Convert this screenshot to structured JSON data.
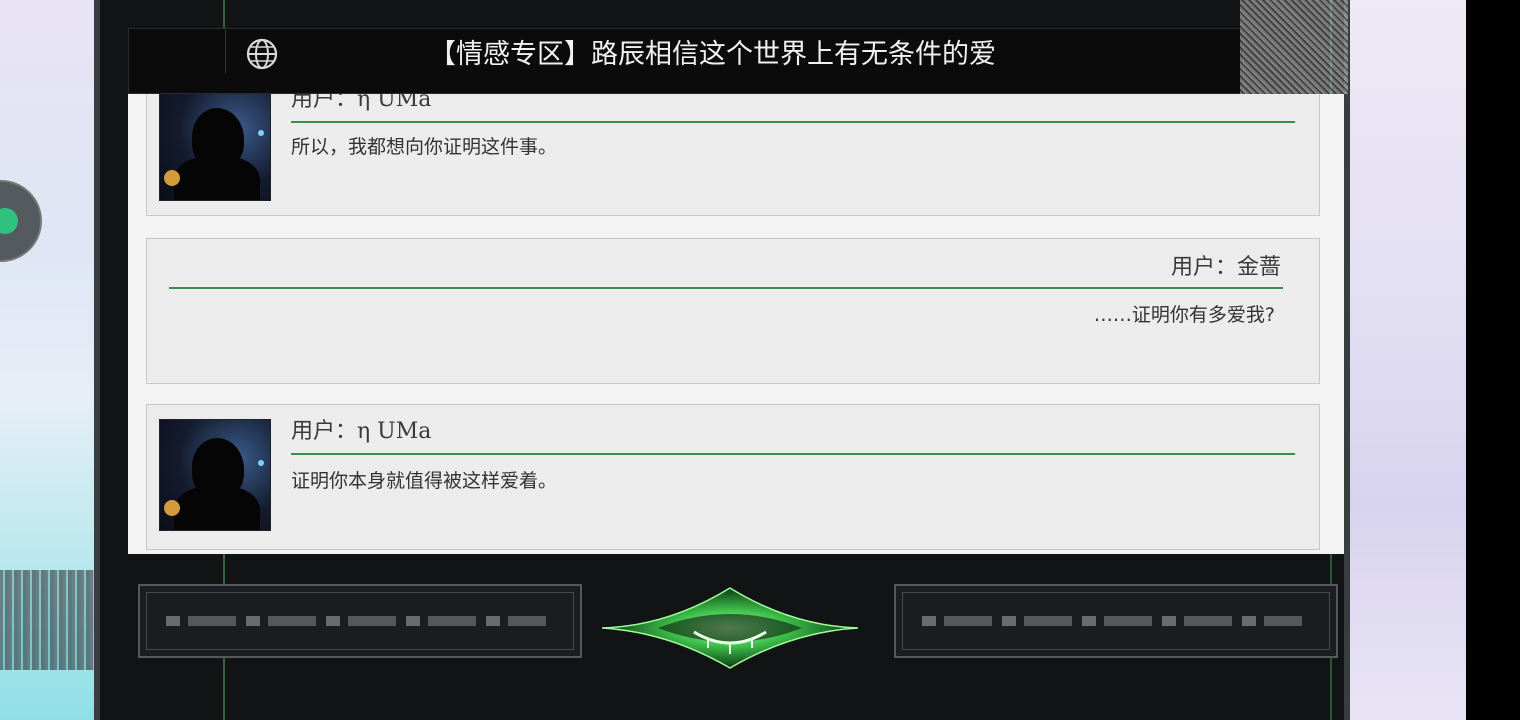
{
  "header": {
    "title": "【情感专区】路辰相信这个世界上有无条件的爱"
  },
  "messages": [
    {
      "side": "left",
      "user": "用户：η UMa",
      "text": "所以，我都想向你证明这件事。",
      "has_avatar": true
    },
    {
      "side": "right",
      "user": "用户：金蔷",
      "text": "……证明你有多爱我?",
      "has_avatar": false
    },
    {
      "side": "left",
      "user": "用户：η UMa",
      "text": "证明你本身就值得被这样爱着。",
      "has_avatar": true
    }
  ],
  "colors": {
    "accent_green": "#3a8f4a",
    "panel": "#ececec",
    "header_bg": "#0b0b0c"
  },
  "icons": {
    "header_left": "globe-icon",
    "center_emblem": "green-eye-emblem",
    "float_button": "assistive-touch-icon"
  }
}
